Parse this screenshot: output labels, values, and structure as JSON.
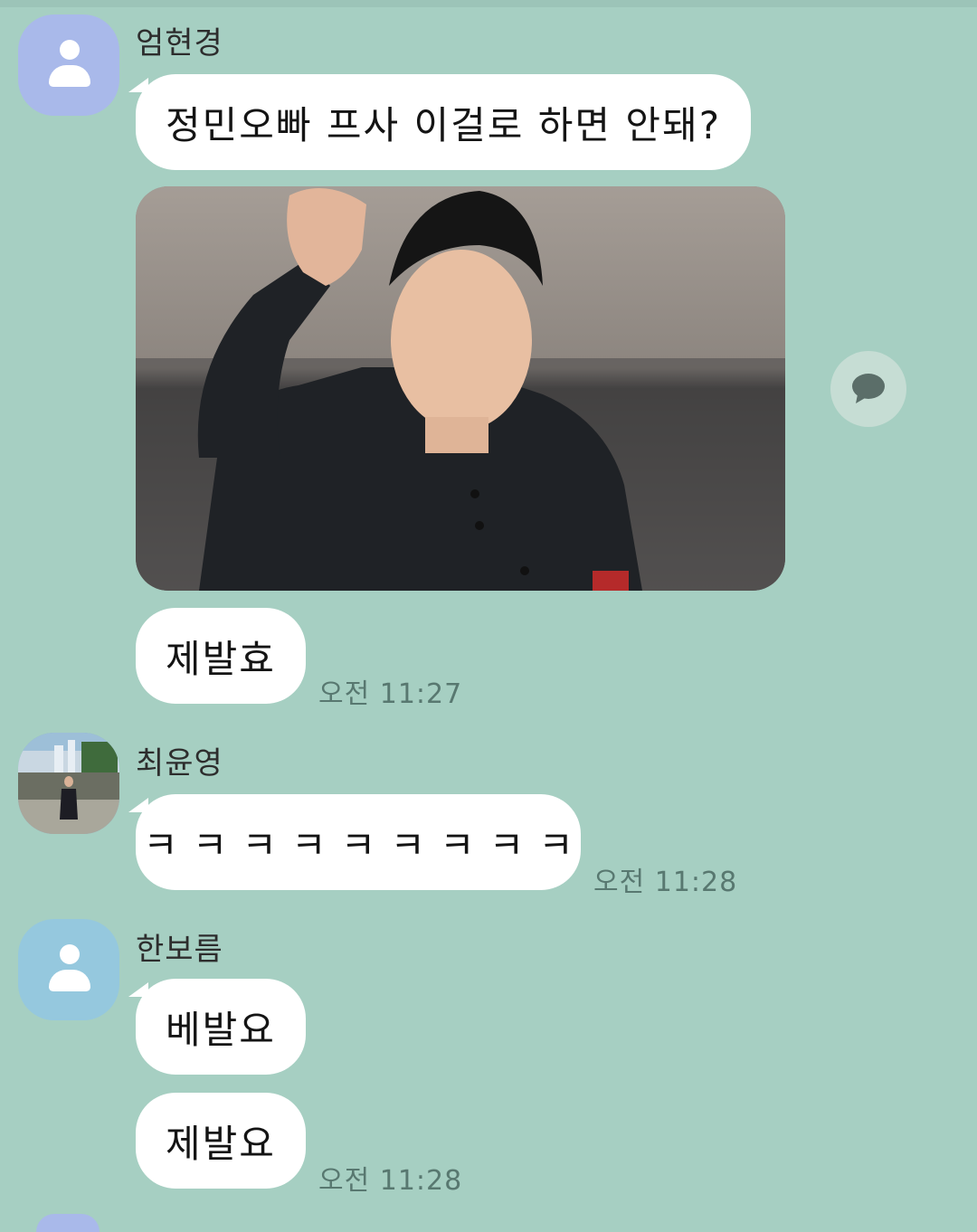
{
  "messages": [
    {
      "sender": "엄현경",
      "text": "정민오빠 프사 이걸로 하면 안돼?"
    },
    {
      "text": "제발효",
      "time": "오전 11:27"
    },
    {
      "sender": "최윤영",
      "text": "ㅋㅋㅋㅋㅋㅋㅋㅋㅋ",
      "time": "오전 11:28"
    },
    {
      "sender": "한보름",
      "text": "베발요"
    },
    {
      "text": "제발요",
      "time": "오전 11:28"
    }
  ],
  "icons": {
    "default_avatar": "person-icon",
    "share": "speech-bubble-icon"
  },
  "colors": {
    "background": "#a6cfc2",
    "bubble": "#ffffff",
    "avatar_1": "#a9b9ea",
    "avatar_3": "#95c8de"
  }
}
